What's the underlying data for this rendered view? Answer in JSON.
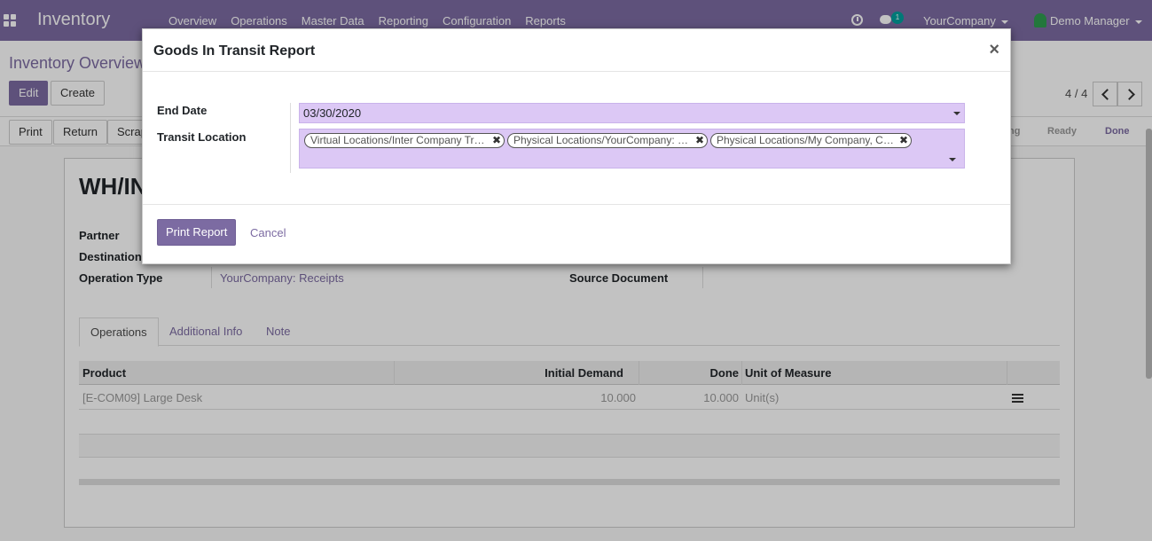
{
  "navbar": {
    "brand": "Inventory",
    "menu": [
      "Overview",
      "Operations",
      "Master Data",
      "Reporting",
      "Configuration",
      "Reports"
    ],
    "chat_count": "1",
    "company": "YourCompany",
    "user": "Demo Manager"
  },
  "control": {
    "breadcrumb": "Inventory Overview",
    "edit": "Edit",
    "create": "Create",
    "pager": "4 / 4"
  },
  "statusbar": {
    "buttons": [
      "Print",
      "Return",
      "Scrap"
    ],
    "stages": [
      "ng",
      "Ready",
      "Done"
    ]
  },
  "form": {
    "title": "WH/IN",
    "labels": {
      "partner": "Partner",
      "destination": "Destination",
      "operation_type": "Operation Type",
      "source_document": "Source Document"
    },
    "operation_type_value": "YourCompany: Receipts",
    "tabs": [
      "Operations",
      "Additional Info",
      "Note"
    ],
    "columns": {
      "product": "Product",
      "initial_demand": "Initial Demand",
      "done": "Done",
      "uom": "Unit of Measure"
    },
    "rows": [
      {
        "product": "[E-COM09] Large Desk",
        "initial_demand": "10.000",
        "done": "10.000",
        "uom": "Unit(s)"
      }
    ]
  },
  "modal": {
    "title": "Goods In Transit Report",
    "close": "×",
    "end_date_label": "End Date",
    "end_date_value": "03/30/2020",
    "transit_location_label": "Transit Location",
    "tags": [
      "Virtual Locations/Inter Company Tr…",
      "Physical Locations/YourCompany: …",
      "Physical Locations/My Company, C…"
    ],
    "tag_remove": "✖",
    "print_report": "Print Report",
    "cancel": "Cancel"
  }
}
